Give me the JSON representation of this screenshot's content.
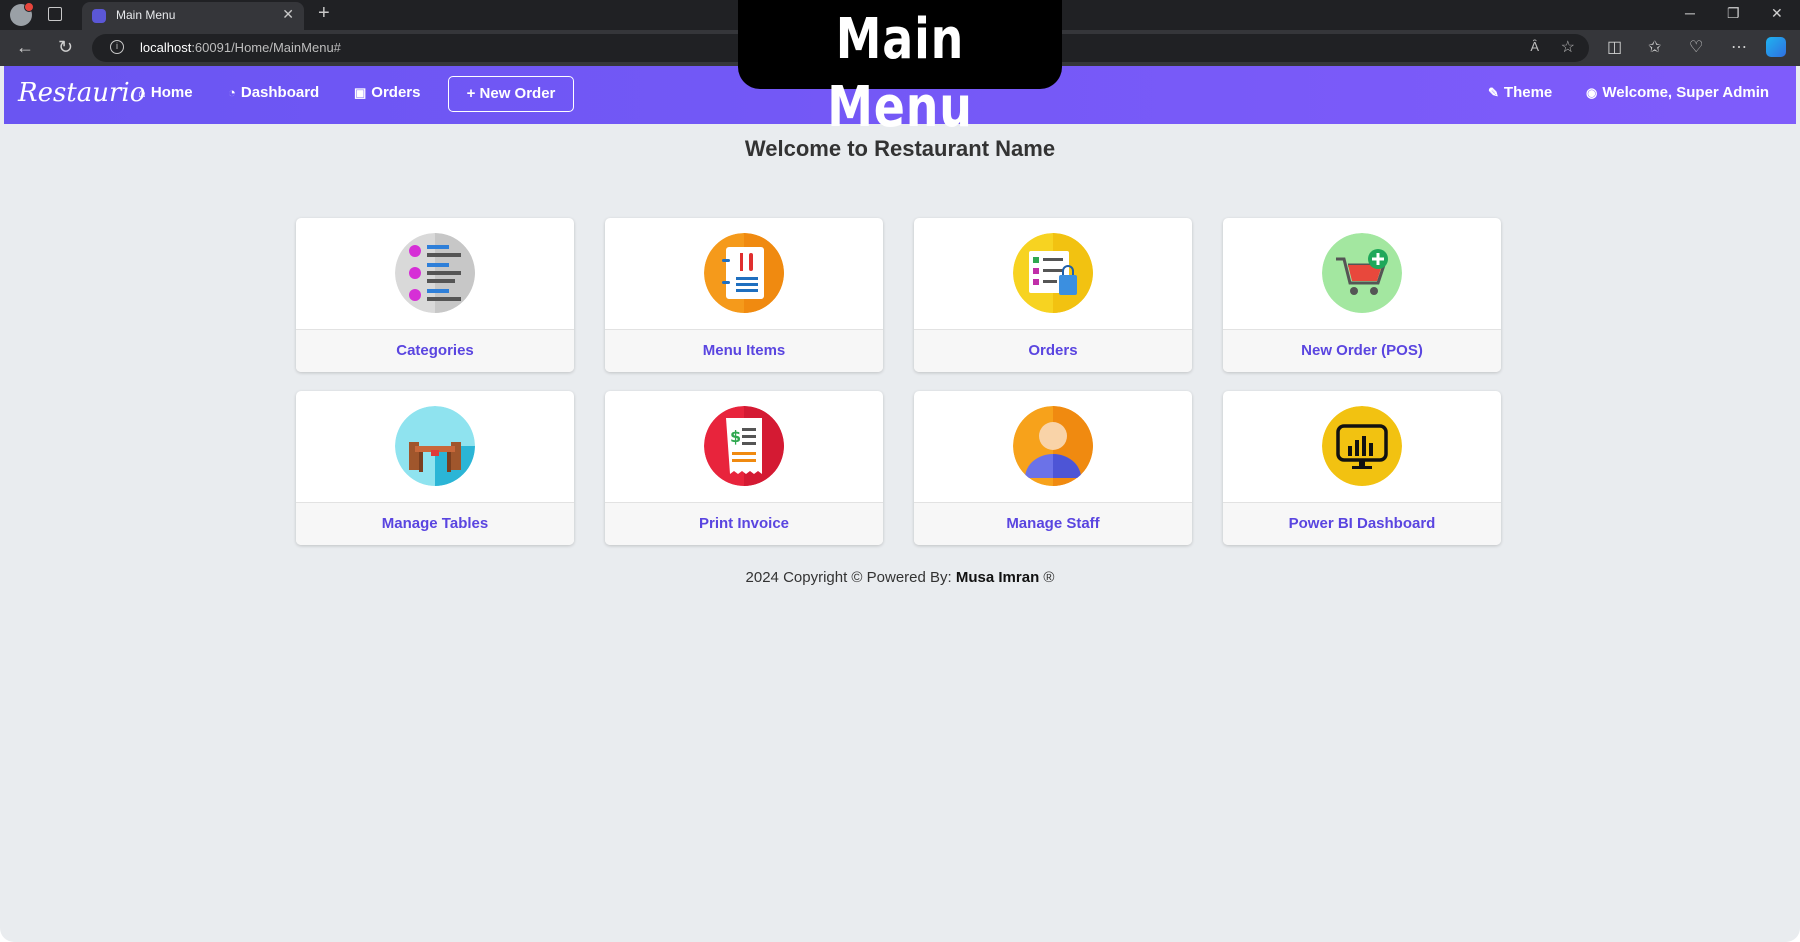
{
  "browser": {
    "tab_title": "Main Menu",
    "tab_close": "✕",
    "new_tab": "+",
    "url_host": "localhost",
    "url_rest": ":60091/Home/MainMenu#",
    "read_aloud": "Ȃ",
    "win_min": "─",
    "win_restore": "❐",
    "win_close": "✕"
  },
  "overlay_title": "Main Menu",
  "navbar": {
    "brand": "Restaurio",
    "home": "Home",
    "dashboard": "Dashboard",
    "orders": "Orders",
    "new_order": "+ New Order",
    "theme": "Theme",
    "welcome_user": "Welcome, Super Admin"
  },
  "main": {
    "welcome": "Welcome to Restaurant Name",
    "cards": [
      {
        "label": "Categories",
        "icon": "categories-icon"
      },
      {
        "label": "Menu Items",
        "icon": "menu-items-icon"
      },
      {
        "label": "Orders",
        "icon": "orders-icon"
      },
      {
        "label": "New Order (POS)",
        "icon": "new-order-cart-icon"
      },
      {
        "label": "Manage Tables",
        "icon": "tables-icon"
      },
      {
        "label": "Print Invoice",
        "icon": "invoice-icon"
      },
      {
        "label": "Manage Staff",
        "icon": "staff-icon"
      },
      {
        "label": "Power BI Dashboard",
        "icon": "power-bi-icon"
      }
    ]
  },
  "footer": {
    "text": "2024 Copyright © Powered By: ",
    "author": "Musa Imran",
    "mark": " ®"
  },
  "colors": {
    "navbar": "#7059f5",
    "accent_text": "#5a45e0",
    "page_bg": "#e9ecef"
  }
}
